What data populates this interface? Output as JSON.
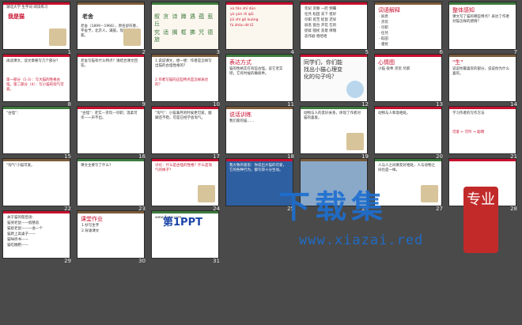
{
  "view": "slide-sorter",
  "slides": [
    {
      "n": "1",
      "title": "我是猫",
      "sub": "湖北大学 生字词 阅读练习",
      "color": "#c8102e"
    },
    {
      "n": "2",
      "title": "老舍",
      "text": "老舍（1899－1966），原名舒庆春，字舍予，北京人，满族。现代著名作家。"
    },
    {
      "n": "3",
      "chars": "叙 贪 诗 蹲 遇 蕴 惹 丘",
      "chars2": "究 适 搁 框 拂 咒 德 旅"
    },
    {
      "n": "4",
      "rows": [
        "xù tān shī dūn",
        "yù yùn rě qiū",
        "jiū shì gē kuàng",
        "fú zhòu dé lǚ"
      ]
    },
    {
      "n": "5",
      "rows": [
        "年纪 贪静 一腔 倒霉",
        "任凭 稻田 丢下 挺好",
        "尽职 贫苦 捉鼠 迟早",
        "屏息 窗台 开花 在的",
        "捉蚌 骚扰 恶意 哮喘",
        "恶作剧 哈哈哈"
      ]
    },
    {
      "n": "6",
      "head": "词语解释",
      "rows": [
        "· 屏息",
        "· 贪玩",
        "· 尽职",
        "· 任凭",
        "· 稻田",
        "· 骚扰"
      ]
    },
    {
      "n": "7",
      "head": "整体感知",
      "text": "课文写了猫的哪些特点？表达了作者对猫怎样的感情？"
    },
    {
      "n": "8",
      "text": "再读课文，读文章要写几个部分？",
      "text2": "第一部分（1-3）：写大猫的性格古怪。第二部分（4）：写小猫的淘气可爱。"
    },
    {
      "n": "9",
      "text": "老舍写猫有什么特点？请结合课文回答。"
    },
    {
      "n": "10",
      "text": "1.说说课文，想一想：作者是怎样写出猫的古怪性格的？",
      "text2": "2.作者写猫的这些特点是怎样表达的？"
    },
    {
      "n": "11",
      "head": "表达方式",
      "text": "猫的性格实在有些古怪。说它老实吧，它有时候的确很乖。"
    },
    {
      "n": "12",
      "text": "同学们，你们能找出小猫心理变化的句子吗？"
    },
    {
      "n": "13",
      "head": "心情图",
      "text": "小猫 很乖 贪玩 尽职"
    },
    {
      "n": "14",
      "head": "\"生\"",
      "text": "说说你最喜欢的部分，说说你为什么喜欢。"
    },
    {
      "n": "15",
      "text": "\"古怪\"："
    },
    {
      "n": "16",
      "text": "\"古怪\"：老实—贪玩—尽职；温柔可亲—一声不出。"
    },
    {
      "n": "17",
      "text": "\"淘气\"：小猫满月的时候更可爱，腿脚还不稳，可是已经学会淘气。"
    },
    {
      "n": "18",
      "head": "说话训练",
      "text": "我们家的猫……"
    },
    {
      "n": "19",
      "text": "动物与人的友好关系，体现了作者对猫的喜爱。"
    },
    {
      "n": "20",
      "text": "动物与人和谐相处。"
    },
    {
      "n": "21",
      "text": "学习作者的写作方法",
      "text2": "可爱 ← 可怜 → 聪明"
    },
    {
      "n": "22",
      "text": "\"淘气\"小猫可爱。"
    },
    {
      "n": "23",
      "text": "课文主要写了什么？"
    },
    {
      "n": "24",
      "text": "讨论：什么是古怪的性格？什么是淘气的样子？",
      "color": "#c8102e"
    },
    {
      "n": "25",
      "text": "我大致的意思：你说出大猫的可爱，它的各种行为，都写得十分生动。",
      "color": "#ffffff"
    },
    {
      "n": "26",
      "text": ""
    },
    {
      "n": "27",
      "text": "人与人之间要友好相处，人与动物之间也是一样。"
    },
    {
      "n": "28",
      "text": ""
    },
    {
      "n": "29",
      "rows": [
        "关于猫的歇后语：",
        "猫哭老鼠——假慈悲",
        "猫捉老鼠——一会一个",
        "猫爬上高桌子——",
        "猫咪听书——",
        "猫吃糍粑——"
      ]
    },
    {
      "n": "30",
      "head": "课堂作业",
      "rows": [
        "1.抄写生字",
        "2.背诵课文"
      ]
    },
    {
      "n": "31",
      "logo": "第1PPT",
      "text": "www.1ppt.com"
    }
  ],
  "watermark": {
    "main": "下载集",
    "url": "www.xiazai.red",
    "seal": "专业"
  }
}
